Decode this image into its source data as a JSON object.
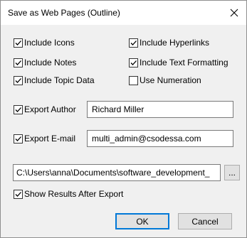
{
  "window": {
    "title": "Save as Web Pages (Outline)",
    "close_icon": "close-icon"
  },
  "options": {
    "include_icons": {
      "label": "Include Icons",
      "checked": true
    },
    "include_hyperlinks": {
      "label": "Include Hyperlinks",
      "checked": true
    },
    "include_notes": {
      "label": "Include Notes",
      "checked": true
    },
    "include_text_formatting": {
      "label": "Include Text Formatting",
      "checked": true
    },
    "include_topic_data": {
      "label": "Include Topic Data",
      "checked": true
    },
    "use_numeration": {
      "label": "Use Numeration",
      "checked": false
    }
  },
  "export_author": {
    "label": "Export Author",
    "checked": true,
    "value": "Richard Miller"
  },
  "export_email": {
    "label": "Export E-mail",
    "checked": true,
    "value": "multi_admin@csodessa.com"
  },
  "path": {
    "value": "C:\\Users\\anna\\Documents\\software_development_",
    "browse_label": "..."
  },
  "show_results": {
    "label": "Show Results After Export",
    "checked": true
  },
  "buttons": {
    "ok": "OK",
    "cancel": "Cancel"
  },
  "colors": {
    "accent": "#0078d7",
    "background": "#f0f0f0"
  }
}
